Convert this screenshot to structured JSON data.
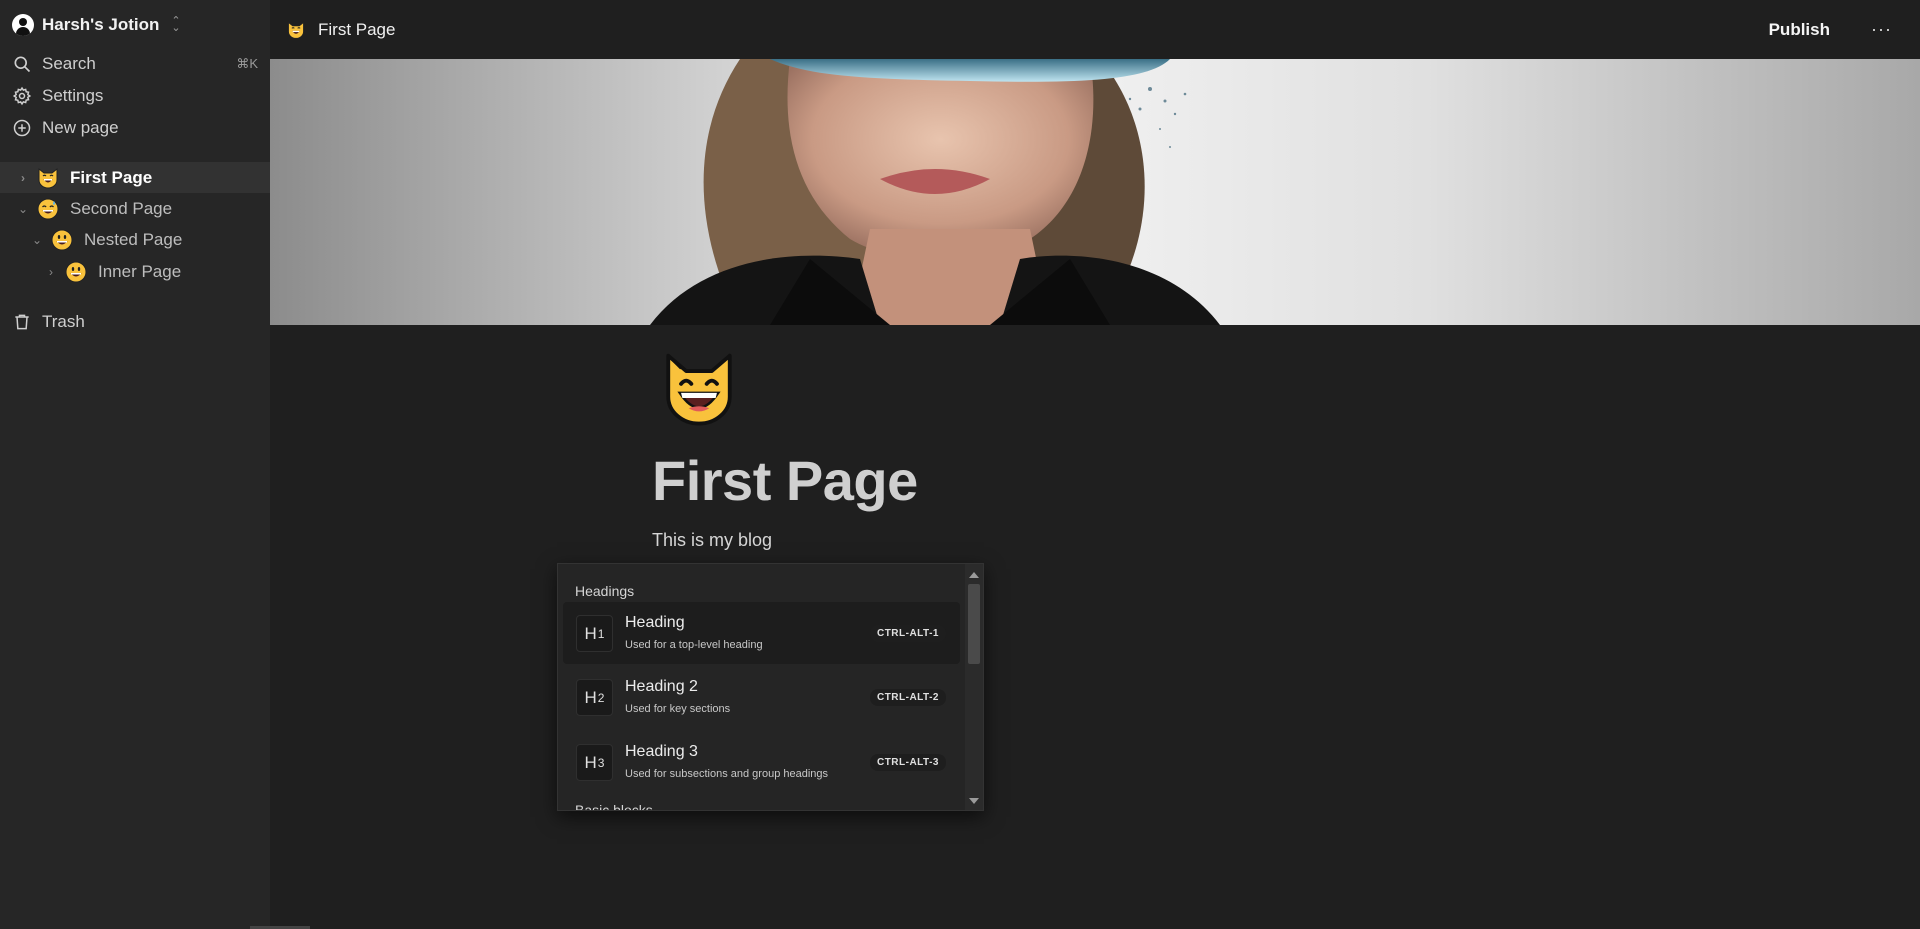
{
  "sidebar": {
    "workspace_name": "Harsh's Jotion",
    "search_label": "Search",
    "search_shortcut": "⌘K",
    "settings_label": "Settings",
    "new_page_label": "New page",
    "trash_label": "Trash",
    "pages": [
      {
        "label": "First Page",
        "icon": "grinning-cat-emoji",
        "expanded": false,
        "active": true
      },
      {
        "label": "Second Page",
        "icon": "grinning-sweat-emoji",
        "expanded": true,
        "active": false
      },
      {
        "label": "Nested Page",
        "icon": "grinning-face-emoji",
        "expanded": true,
        "active": false
      },
      {
        "label": "Inner Page",
        "icon": "grinning-face-emoji",
        "expanded": false,
        "active": false
      }
    ]
  },
  "topbar": {
    "breadcrumb_title": "First Page",
    "breadcrumb_icon": "grinning-cat-emoji",
    "publish_label": "Publish",
    "more_label": "···"
  },
  "page": {
    "icon": "grinning-cat-emoji",
    "title": "First Page",
    "body": "This is my blog"
  },
  "slash_menu": {
    "section_headings": "Headings",
    "section_basic": "Basic blocks",
    "items": [
      {
        "icon_text": "H",
        "icon_sub": "1",
        "title": "Heading",
        "description": "Used for a top-level heading",
        "shortcut": "CTRL-ALT-1"
      },
      {
        "icon_text": "H",
        "icon_sub": "2",
        "title": "Heading 2",
        "description": "Used for key sections",
        "shortcut": "CTRL-ALT-2"
      },
      {
        "icon_text": "H",
        "icon_sub": "3",
        "title": "Heading 3",
        "description": "Used for subsections and group headings",
        "shortcut": "CTRL-ALT-3"
      }
    ]
  },
  "colors": {
    "sidebar_bg": "#262626",
    "main_bg": "#1f1f1f",
    "active_item_bg": "#323232",
    "emoji_yellow": "#f9c23c"
  }
}
